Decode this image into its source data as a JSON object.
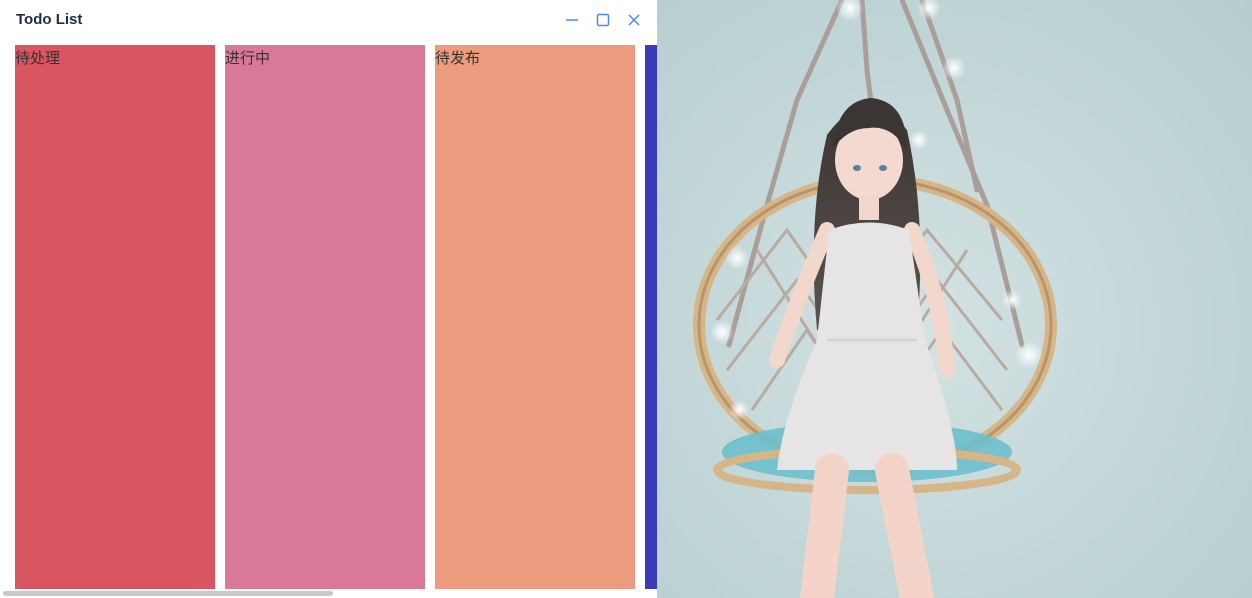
{
  "window": {
    "title": "Todo List",
    "controls": {
      "minimize_icon": "minimize-icon",
      "maximize_icon": "maximize-icon",
      "close_icon": "close-icon",
      "accent": "#4a8be8"
    }
  },
  "board": {
    "columns": [
      {
        "label": "待处理",
        "color": "#d95562"
      },
      {
        "label": "进行中",
        "color": "#d87a97"
      },
      {
        "label": "待发布",
        "color": "#ec9b7f"
      },
      {
        "label": "",
        "color": "#3b3bb8"
      }
    ]
  },
  "wallpaper": {
    "subject": "girl-on-hanging-swing-chair",
    "background_color": "#c3d6d8"
  }
}
